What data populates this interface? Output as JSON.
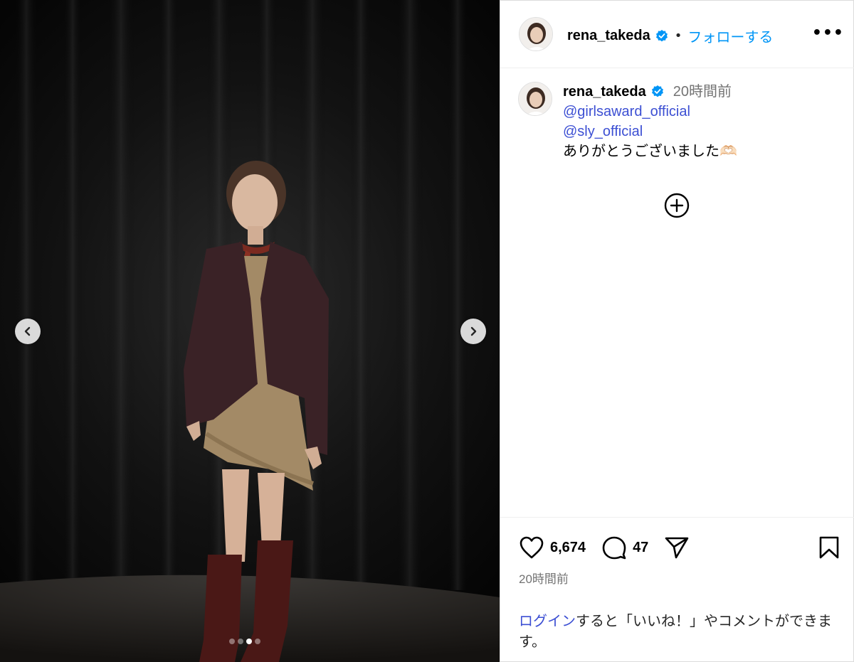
{
  "post": {
    "username": "rena_takeda",
    "follow_label": "フォローする",
    "separator": "•",
    "more_label": "•••"
  },
  "photo": {
    "carousel_total": 4,
    "carousel_active": 3
  },
  "caption": {
    "username": "rena_takeda",
    "time": "20時間前",
    "mentions": [
      "@girlsaward_official",
      "@sly_official"
    ],
    "text": "ありがとうございました🫶🏻"
  },
  "actions": {
    "likes": "6,674",
    "comments": "47"
  },
  "date_label": "20時間前",
  "login": {
    "link": "ログイン",
    "rest": "すると「いいね！」やコメントができます。"
  },
  "colors": {
    "link": "#3c4fd3",
    "follow": "#0095f6",
    "verified": "#0095f6",
    "muted": "#737373"
  },
  "icons": [
    "chevron-left-icon",
    "chevron-right-icon",
    "verified-icon",
    "more-icon",
    "plus-circle-icon",
    "heart-icon",
    "comment-icon",
    "share-icon",
    "bookmark-icon"
  ]
}
